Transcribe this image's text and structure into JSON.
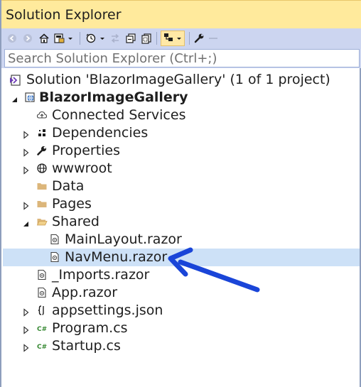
{
  "panel": {
    "title": "Solution Explorer"
  },
  "search": {
    "placeholder": "Search Solution Explorer (Ctrl+;)"
  },
  "toolbar": {
    "buttons": [
      "back-icon",
      "forward-icon",
      "home-icon",
      "switch-views-icon",
      "pending-changes-icon",
      "sync-icon",
      "collapse-all-icon",
      "show-all-files-icon",
      "preview-selected-icon",
      "properties-icon",
      "dash-icon"
    ]
  },
  "tree": {
    "solution": "Solution 'BlazorImageGallery' (1 of 1 project)",
    "project": "BlazorImageGallery",
    "connected_services": "Connected Services",
    "dependencies": "Dependencies",
    "properties": "Properties",
    "wwwroot": "wwwroot",
    "data": "Data",
    "pages": "Pages",
    "shared": "Shared",
    "main_layout": "MainLayout.razor",
    "nav_menu": "NavMenu.razor",
    "imports": "_Imports.razor",
    "app": "App.razor",
    "appsettings": "appsettings.json",
    "program": "Program.cs",
    "startup": "Startup.cs"
  },
  "colors": {
    "title_bar": "#ffea9c",
    "toolbar": "#ccd5f0",
    "selection": "#cde1f7",
    "callout_arrow": "#1a45d8"
  }
}
